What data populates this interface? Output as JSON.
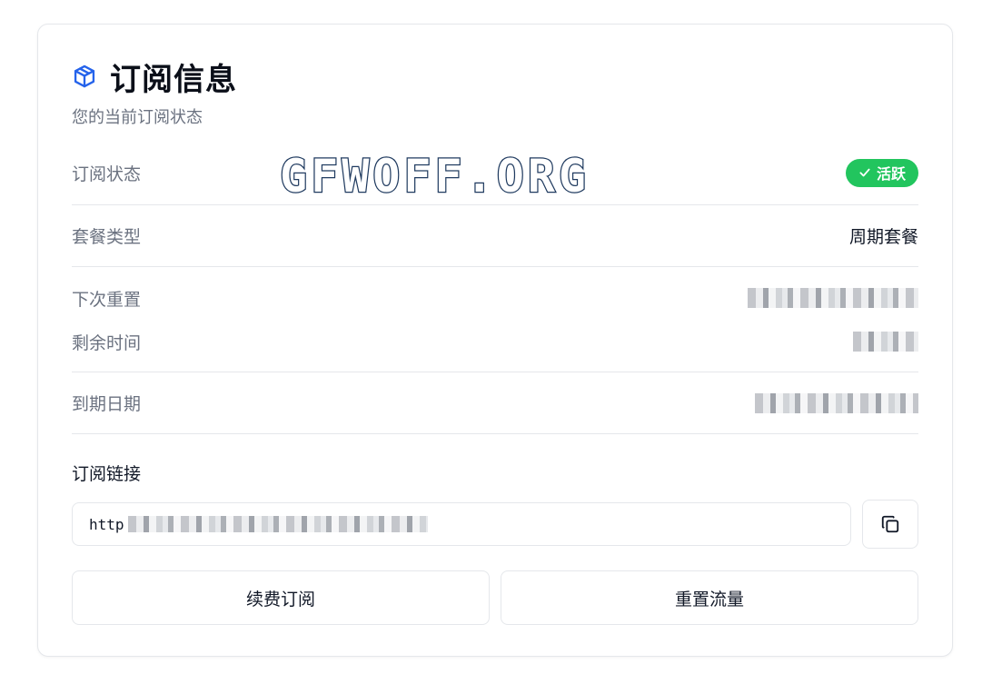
{
  "header": {
    "title": "订阅信息",
    "subtitle": "您的当前订阅状态",
    "icon": "package-icon"
  },
  "watermark": "GFWOFF.ORG",
  "rows": {
    "status": {
      "label": "订阅状态",
      "badge": "活跃",
      "badge_color": "#22c55e"
    },
    "plan": {
      "label": "套餐类型",
      "value": "周期套餐"
    },
    "next_reset": {
      "label": "下次重置"
    },
    "remaining": {
      "label": "剩余时间"
    },
    "expiry": {
      "label": "到期日期"
    }
  },
  "subscription_link": {
    "label": "订阅链接",
    "value_prefix": "http",
    "copy_icon": "copy-icon"
  },
  "actions": {
    "renew": "续费订阅",
    "reset_traffic": "重置流量"
  },
  "colors": {
    "accent_icon": "#2563eb",
    "success": "#22c55e",
    "border": "#e5e7eb",
    "muted_text": "#6b7280"
  }
}
